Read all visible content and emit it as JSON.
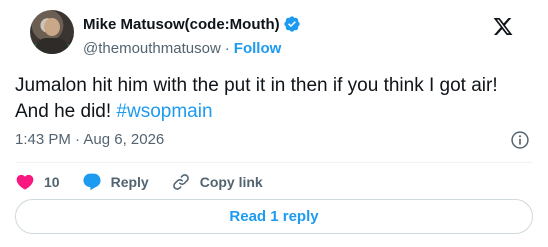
{
  "author": {
    "name": "Mike Matusow(code:Mouth)",
    "handle": "@themouthmatusow",
    "follow_label": "Follow",
    "separator": "·"
  },
  "tweet": {
    "text": "Jumalon hit him with the put it in then if you think I got air! And he did! ",
    "hashtag": "#wsopmain",
    "timestamp": "1:43 PM · Aug 6, 2026"
  },
  "actions": {
    "like_count": "10",
    "reply_label": "Reply",
    "copy_link_label": "Copy link"
  },
  "read_replies_label": "Read 1 reply",
  "colors": {
    "accent": "#1d9bf0",
    "like": "#f91880",
    "muted": "#536471",
    "text": "#0f1419"
  },
  "icons": [
    "verified-badge-icon",
    "x-logo-icon",
    "info-icon",
    "heart-icon",
    "reply-bubble-icon",
    "link-icon"
  ]
}
